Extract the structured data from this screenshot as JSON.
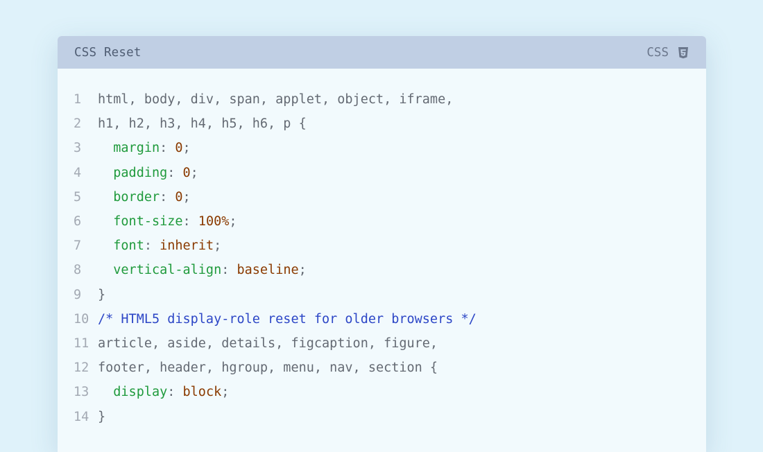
{
  "header": {
    "title": "CSS Reset",
    "language": "CSS",
    "icon": "css3-icon"
  },
  "colors": {
    "background": "#dff2fa",
    "header": "#c0cfe4",
    "card": "#f2fafd",
    "property": "#1f9a3c",
    "value": "#8a3a00",
    "comment": "#2c46c6",
    "text": "#646a73"
  },
  "lines": [
    {
      "num": "1",
      "tokens": [
        {
          "t": "html, body, div, span, applet, object, iframe,",
          "c": "sel"
        }
      ]
    },
    {
      "num": "2",
      "tokens": [
        {
          "t": "h1, h2, h3, h4, h5, h6, p {",
          "c": "sel"
        }
      ]
    },
    {
      "num": "3",
      "tokens": [
        {
          "t": "  ",
          "c": "punct"
        },
        {
          "t": "margin",
          "c": "prop"
        },
        {
          "t": ": ",
          "c": "punct"
        },
        {
          "t": "0",
          "c": "val"
        },
        {
          "t": ";",
          "c": "punct"
        }
      ]
    },
    {
      "num": "4",
      "tokens": [
        {
          "t": "  ",
          "c": "punct"
        },
        {
          "t": "padding",
          "c": "prop"
        },
        {
          "t": ": ",
          "c": "punct"
        },
        {
          "t": "0",
          "c": "val"
        },
        {
          "t": ";",
          "c": "punct"
        }
      ]
    },
    {
      "num": "5",
      "tokens": [
        {
          "t": "  ",
          "c": "punct"
        },
        {
          "t": "border",
          "c": "prop"
        },
        {
          "t": ": ",
          "c": "punct"
        },
        {
          "t": "0",
          "c": "val"
        },
        {
          "t": ";",
          "c": "punct"
        }
      ]
    },
    {
      "num": "6",
      "tokens": [
        {
          "t": "  ",
          "c": "punct"
        },
        {
          "t": "font-size",
          "c": "prop"
        },
        {
          "t": ": ",
          "c": "punct"
        },
        {
          "t": "100%",
          "c": "val"
        },
        {
          "t": ";",
          "c": "punct"
        }
      ]
    },
    {
      "num": "7",
      "tokens": [
        {
          "t": "  ",
          "c": "punct"
        },
        {
          "t": "font",
          "c": "prop"
        },
        {
          "t": ": ",
          "c": "punct"
        },
        {
          "t": "inherit",
          "c": "val"
        },
        {
          "t": ";",
          "c": "punct"
        }
      ]
    },
    {
      "num": "8",
      "tokens": [
        {
          "t": "  ",
          "c": "punct"
        },
        {
          "t": "vertical-align",
          "c": "prop"
        },
        {
          "t": ": ",
          "c": "punct"
        },
        {
          "t": "baseline",
          "c": "val"
        },
        {
          "t": ";",
          "c": "punct"
        }
      ]
    },
    {
      "num": "9",
      "tokens": [
        {
          "t": "}",
          "c": "punct"
        }
      ]
    },
    {
      "num": "10",
      "tokens": [
        {
          "t": "/* HTML5 display-role reset for older browsers */",
          "c": "comment"
        }
      ]
    },
    {
      "num": "11",
      "tokens": [
        {
          "t": "article, aside, details, figcaption, figure,",
          "c": "sel"
        }
      ]
    },
    {
      "num": "12",
      "tokens": [
        {
          "t": "footer, header, hgroup, menu, nav, section {",
          "c": "sel"
        }
      ]
    },
    {
      "num": "13",
      "tokens": [
        {
          "t": "  ",
          "c": "punct"
        },
        {
          "t": "display",
          "c": "prop"
        },
        {
          "t": ": ",
          "c": "punct"
        },
        {
          "t": "block",
          "c": "val"
        },
        {
          "t": ";",
          "c": "punct"
        }
      ]
    },
    {
      "num": "14",
      "tokens": [
        {
          "t": "}",
          "c": "punct"
        }
      ]
    }
  ]
}
